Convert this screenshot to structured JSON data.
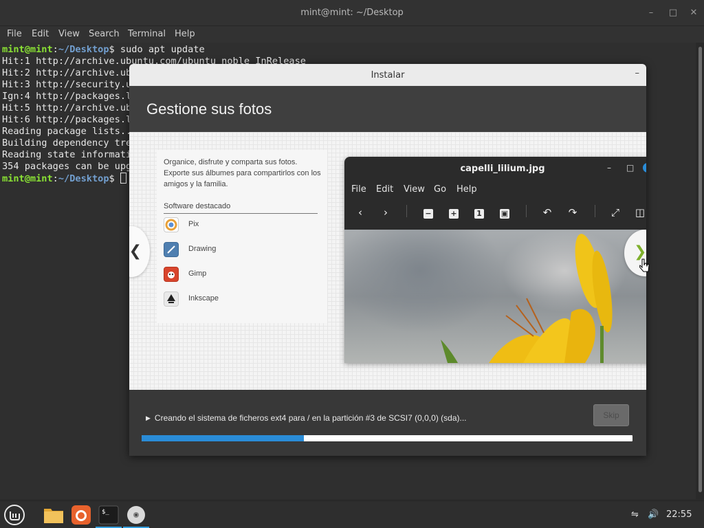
{
  "terminal": {
    "title": "mint@mint: ~/Desktop",
    "menu": [
      "File",
      "Edit",
      "View",
      "Search",
      "Terminal",
      "Help"
    ],
    "prompt_user": "mint@mint",
    "prompt_sep": ":",
    "prompt_path": "~/Desktop",
    "prompt_end": "$ ",
    "command": "sudo apt update",
    "lines": [
      "Hit:1 http://archive.ubuntu.com/ubuntu noble InRelease",
      "Hit:2 http://archive.ub",
      "Hit:3 http://security.u",
      "Ign:4 http://packages.l",
      "Hit:5 http://archive.ub",
      "Hit:6 http://packages.l",
      "Reading package lists..",
      "Building dependency tre",
      "Reading state informati",
      "354 packages can be upg"
    ]
  },
  "installer": {
    "title": "Instalar",
    "heading": "Gestione sus fotos",
    "description": "Organice, disfrute y comparta sus fotos. Exporte sus álbumes para compartirlos con los amigos y la familia.",
    "software_heading": "Software destacado",
    "apps": [
      {
        "name": "Pix",
        "icon": "pix-icon"
      },
      {
        "name": "Drawing",
        "icon": "drawing-icon"
      },
      {
        "name": "Gimp",
        "icon": "gimp-icon"
      },
      {
        "name": "Inkscape",
        "icon": "inkscape-icon"
      }
    ],
    "viewer": {
      "title": "capelli_lilium.jpg",
      "menu": [
        "File",
        "Edit",
        "View",
        "Go",
        "Help"
      ]
    },
    "status": "Creando el sistema de ficheros ext4 para / en la partición #3 de SCSI7 (0,0,0) (sda)...",
    "skip_label": "Skip",
    "progress": 0.33
  },
  "taskbar": {
    "clock": "22:55"
  }
}
